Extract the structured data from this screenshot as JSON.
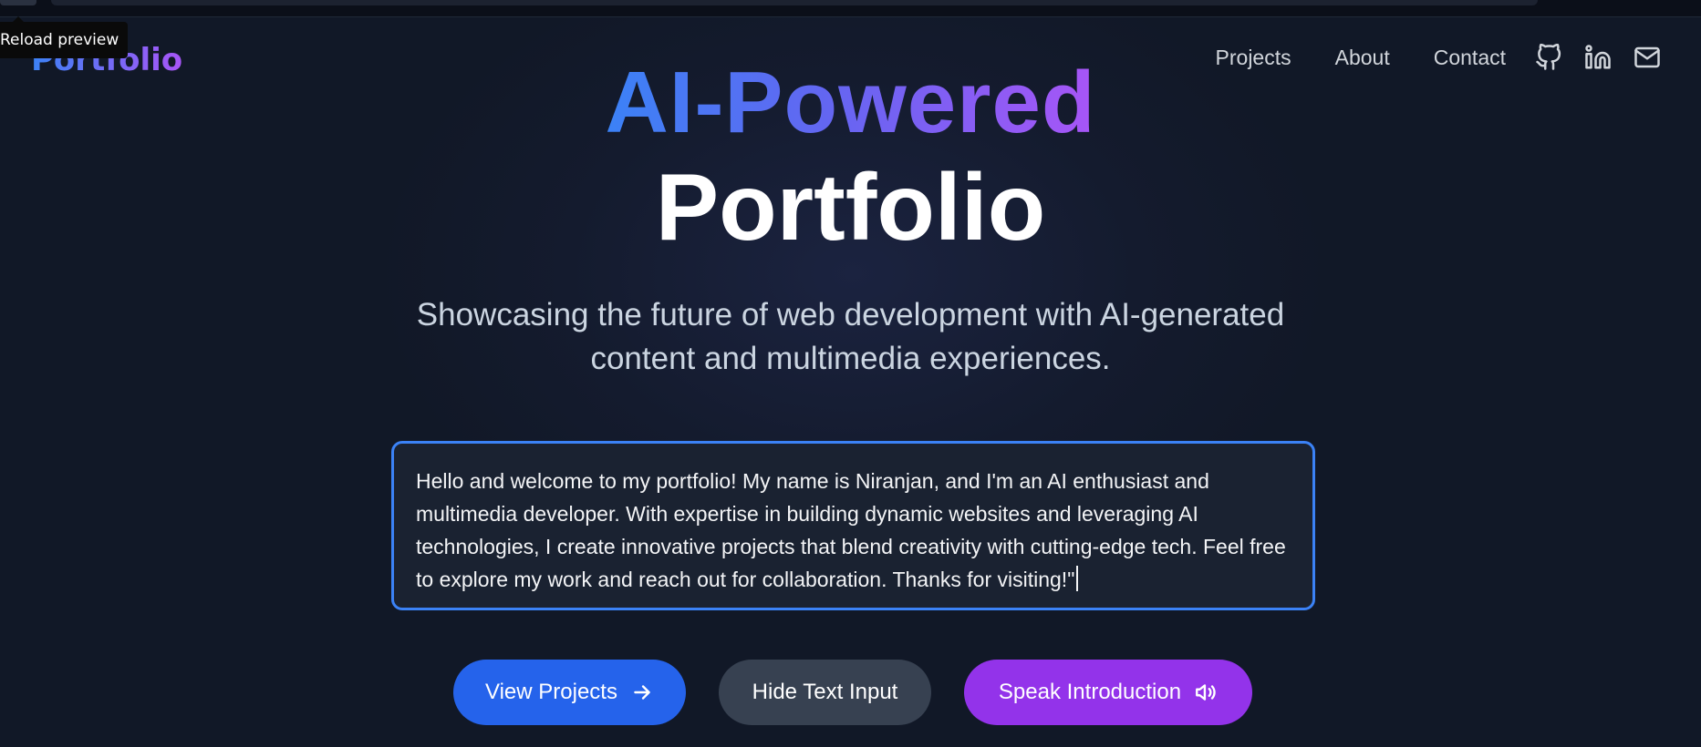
{
  "browser": {
    "tooltip": "Reload preview"
  },
  "header": {
    "logo": "Portfolio",
    "nav": [
      "Projects",
      "About",
      "Contact"
    ],
    "icons": [
      "github-icon",
      "linkedin-icon",
      "mail-icon"
    ]
  },
  "hero": {
    "line1": "AI-Powered",
    "line2": "Portfolio",
    "subtitle": "Showcasing the future of web development with AI-generated content and multimedia experiences."
  },
  "intro": {
    "text": "Hello and welcome to my portfolio! My name is Niranjan, and I'm an AI enthusiast and multimedia developer. With expertise in building dynamic websites and leveraging AI technologies, I create innovative projects that blend creativity with cutting-edge tech. Feel free to explore my work and reach out for collaboration. Thanks for visiting!\""
  },
  "actions": {
    "view_projects": "View Projects",
    "hide_text": "Hide Text Input",
    "speak": "Speak Introduction"
  },
  "colors": {
    "background": "#131a2b",
    "accent_blue": "#2563eb",
    "accent_purple": "#9333ea",
    "secondary": "#374151",
    "focus_border": "#3b82f6"
  }
}
